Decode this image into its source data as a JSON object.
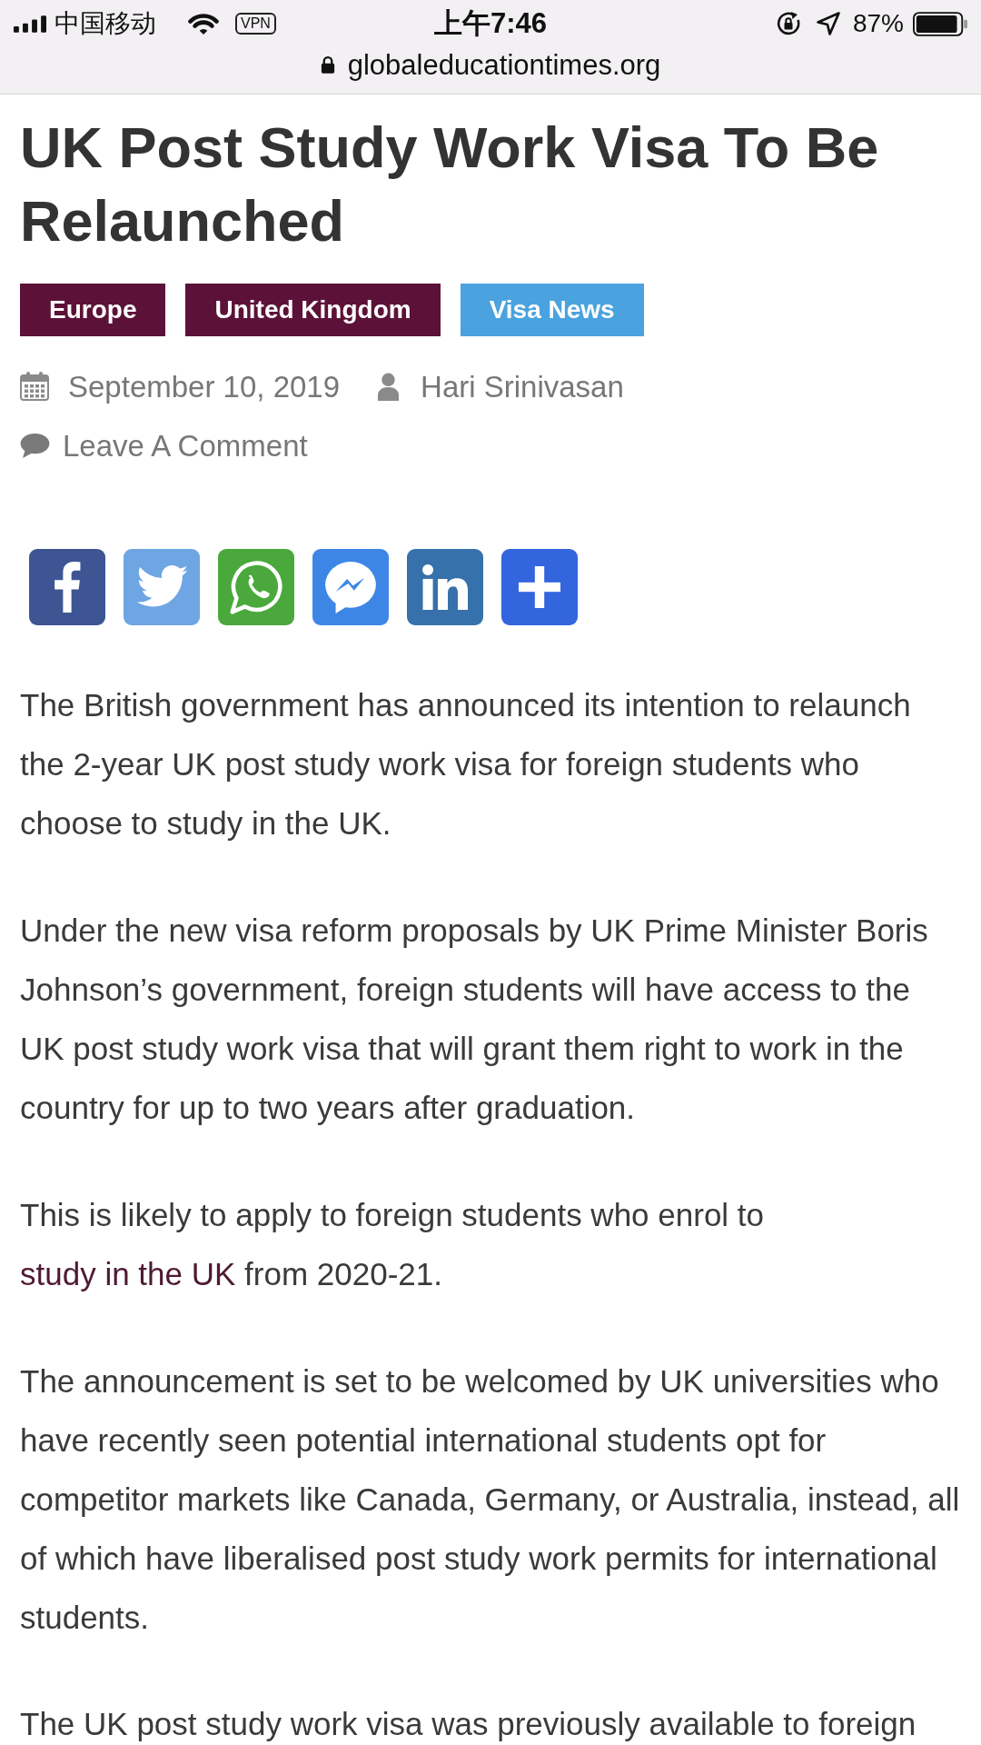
{
  "status_bar": {
    "carrier": "中国移动",
    "vpn": "VPN",
    "time": "上午7:46",
    "battery": "87%"
  },
  "address_bar": {
    "url": "globaleducationtimes.org"
  },
  "article": {
    "title": "UK Post Study Work Visa To Be Relaunched",
    "tags": [
      {
        "label": "Europe",
        "color": "#5c1238"
      },
      {
        "label": "United Kingdom",
        "color": "#5c1238"
      },
      {
        "label": "Visa News",
        "color": "#4aa3df"
      }
    ],
    "meta": {
      "date": "September 10, 2019",
      "author": "Hari Srinivasan",
      "comment_link": "Leave A Comment"
    },
    "share_buttons": [
      {
        "kind": "facebook"
      },
      {
        "kind": "twitter"
      },
      {
        "kind": "whatsapp"
      },
      {
        "kind": "messenger"
      },
      {
        "kind": "linkedin"
      },
      {
        "kind": "more"
      }
    ],
    "paragraphs": [
      {
        "parts": [
          {
            "kind": "text",
            "text": "The British government has announced its intention to relaunch the 2-year UK post study work visa for foreign students who choose to study in the UK."
          }
        ]
      },
      {
        "parts": [
          {
            "kind": "text",
            "text": "Under the new visa reform proposals by UK Prime Minister Boris Johnson’s government, foreign students will have access to the UK post study work visa that will grant them right to work in the country for up to two years after graduation."
          }
        ]
      },
      {
        "parts": [
          {
            "kind": "text",
            "text": "This is likely to apply to foreign students who enrol to "
          },
          {
            "kind": "link",
            "text": "study in the UK"
          },
          {
            "kind": "text",
            "text": " from 2020-21."
          }
        ]
      },
      {
        "parts": [
          {
            "kind": "text",
            "text": "The announcement is set to be welcomed by UK universities who have recently seen potential international students opt for competitor markets like Canada, Germany, or Australia, instead, all of which have liberalised post study work permits for international students."
          }
        ]
      },
      {
        "parts": [
          {
            "kind": "text",
            "text": "The UK post study work visa was previously available to foreign"
          }
        ]
      }
    ]
  }
}
